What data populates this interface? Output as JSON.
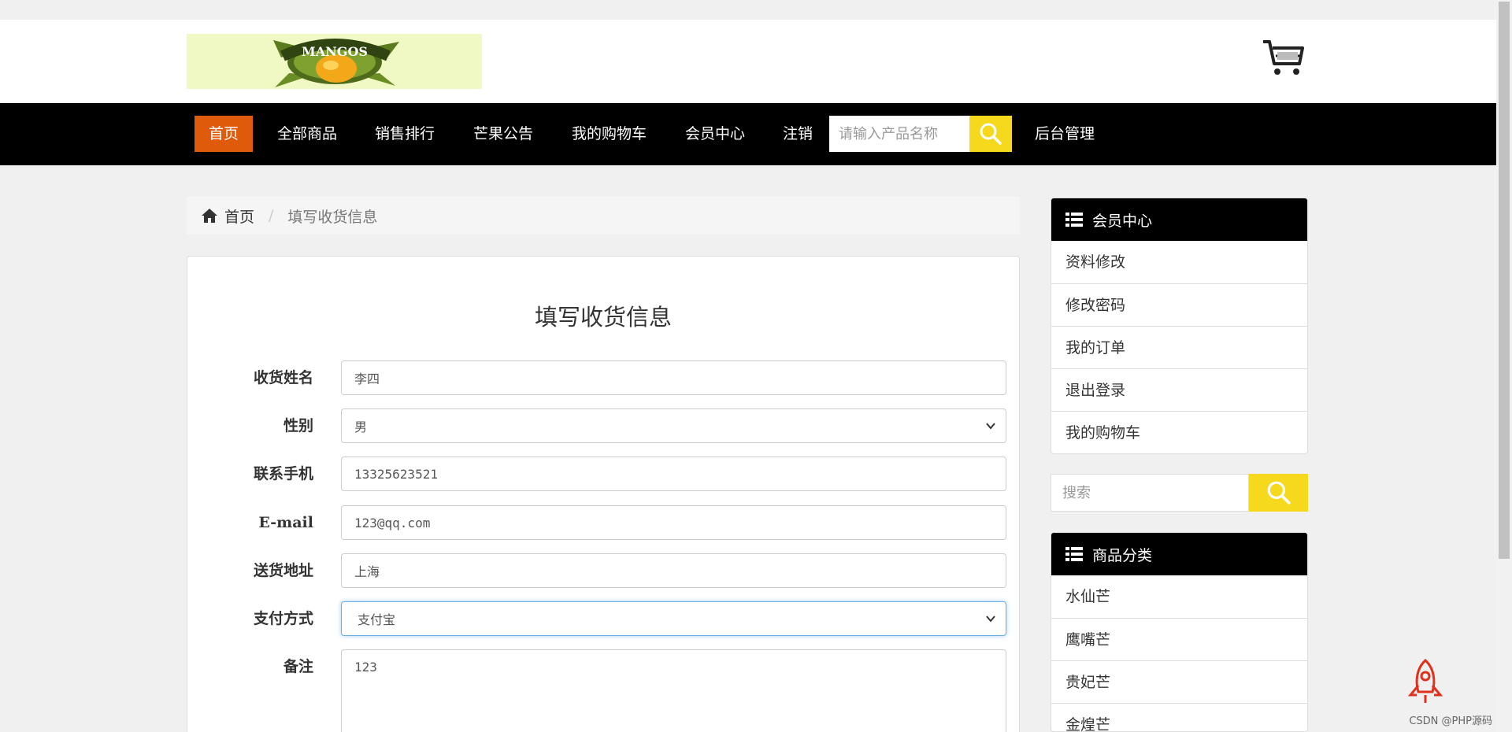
{
  "header": {
    "logo_text": "MANGOS"
  },
  "nav": {
    "items": [
      {
        "label": "首页",
        "active": true
      },
      {
        "label": "全部商品"
      },
      {
        "label": "销售排行"
      },
      {
        "label": "芒果公告"
      },
      {
        "label": "我的购物车"
      },
      {
        "label": "会员中心"
      },
      {
        "label": "注销"
      }
    ],
    "search_placeholder": "请输入产品名称",
    "admin_label": "后台管理"
  },
  "breadcrumb": {
    "home": "首页",
    "separator": "/",
    "current": "填写收货信息"
  },
  "form": {
    "title": "填写收货信息",
    "fields": [
      {
        "label": "收货姓名",
        "value": "李四"
      },
      {
        "label": "性别",
        "value": "男"
      },
      {
        "label": "联系手机",
        "value": "13325623521"
      },
      {
        "label": "E-mail",
        "value": "123@qq.com"
      },
      {
        "label": "送货地址",
        "value": "上海"
      },
      {
        "label": "支付方式",
        "value": "支付宝"
      },
      {
        "label": "备注",
        "value": "123"
      }
    ]
  },
  "sidebar": {
    "member": {
      "title": "会员中心",
      "items": [
        "资料修改",
        "修改密码",
        "我的订单",
        "退出登录",
        "我的购物车"
      ]
    },
    "search_placeholder": "搜索",
    "category": {
      "title": "商品分类",
      "items": [
        "水仙芒",
        "鹰嘴芒",
        "贵妃芒",
        "金煌芒"
      ]
    }
  },
  "watermark": "CSDN @PHP源码",
  "colors": {
    "nav_bg": "#000000",
    "nav_active": "#e05a0c",
    "search_btn": "#f6d81c"
  }
}
